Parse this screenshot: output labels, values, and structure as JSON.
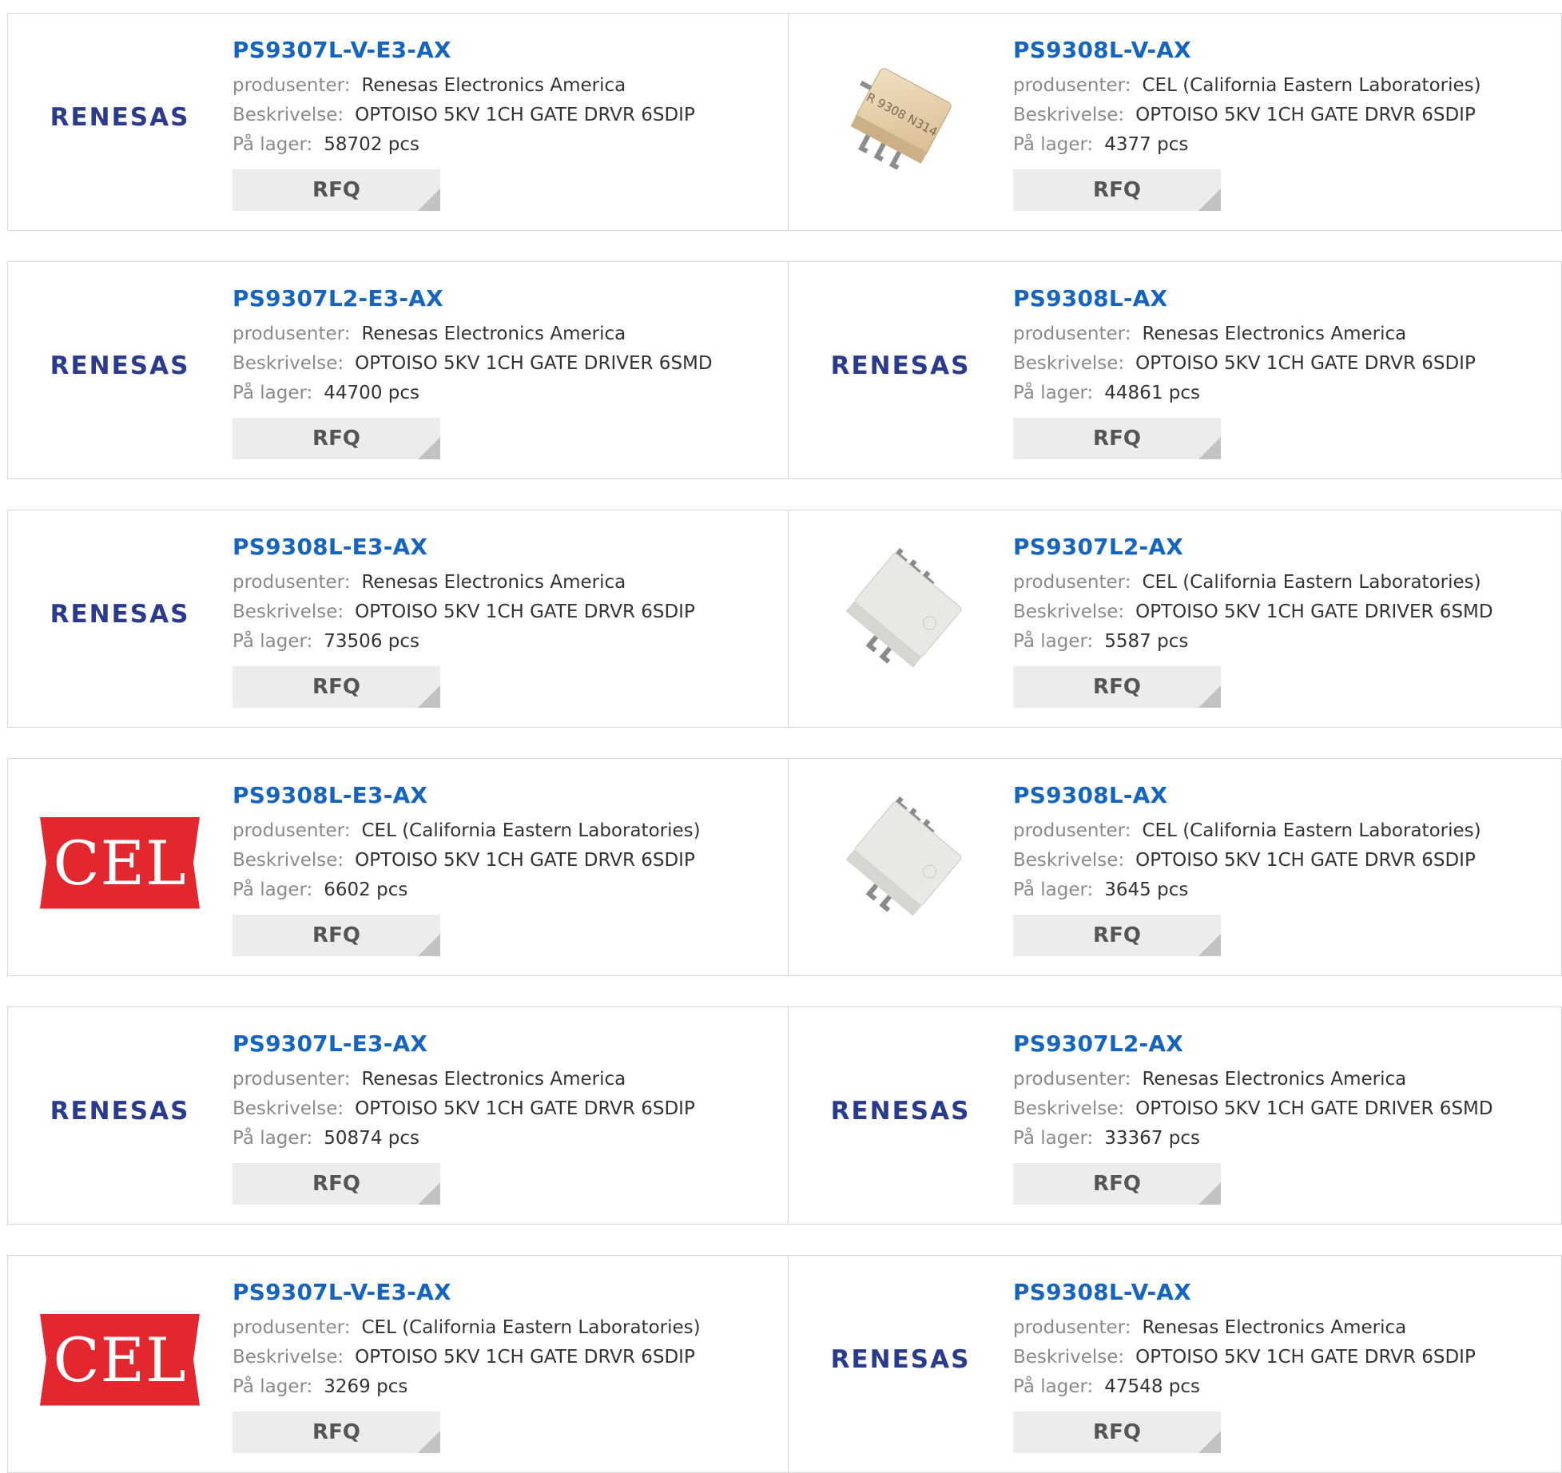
{
  "labels": {
    "maker": "produsenter:",
    "desc": "Beskrivelse:",
    "stock": "På lager:",
    "rfq": "RFQ"
  },
  "rows": [
    [
      {
        "part": "PS9307L-V-E3-AX",
        "maker": "Renesas Electronics America",
        "desc": "OPTOISO 5KV 1CH GATE DRVR 6SDIP",
        "stock": "58702 pcs",
        "image": "renesas-logo",
        "logo_text": "RENESAS"
      },
      {
        "part": "PS9308L-V-AX",
        "maker": "CEL (California Eastern Laboratories)",
        "desc": "OPTOISO 5KV 1CH GATE DRVR 6SDIP",
        "stock": "4377 pcs",
        "image": "chip-tan",
        "chip_mark": "R 9308 N314"
      }
    ],
    [
      {
        "part": "PS9307L2-E3-AX",
        "maker": "Renesas Electronics America",
        "desc": "OPTOISO 5KV 1CH GATE DRIVER 6SMD",
        "stock": "44700 pcs",
        "image": "renesas-logo",
        "logo_text": "RENESAS"
      },
      {
        "part": "PS9308L-AX",
        "maker": "Renesas Electronics America",
        "desc": "OPTOISO 5KV 1CH GATE DRVR 6SDIP",
        "stock": "44861 pcs",
        "image": "renesas-logo",
        "logo_text": "RENESAS"
      }
    ],
    [
      {
        "part": "PS9308L-E3-AX",
        "maker": "Renesas Electronics America",
        "desc": "OPTOISO 5KV 1CH GATE DRVR 6SDIP",
        "stock": "73506 pcs",
        "image": "renesas-logo",
        "logo_text": "RENESAS"
      },
      {
        "part": "PS9307L2-AX",
        "maker": "CEL (California Eastern Laboratories)",
        "desc": "OPTOISO 5KV 1CH GATE DRIVER 6SMD",
        "stock": "5587 pcs",
        "image": "chip-white"
      }
    ],
    [
      {
        "part": "PS9308L-E3-AX",
        "maker": "CEL (California Eastern Laboratories)",
        "desc": "OPTOISO 5KV 1CH GATE DRVR 6SDIP",
        "stock": "6602 pcs",
        "image": "cel-logo",
        "logo_text": "CEL"
      },
      {
        "part": "PS9308L-AX",
        "maker": "CEL (California Eastern Laboratories)",
        "desc": "OPTOISO 5KV 1CH GATE DRVR 6SDIP",
        "stock": "3645 pcs",
        "image": "chip-white"
      }
    ],
    [
      {
        "part": "PS9307L-E3-AX",
        "maker": "Renesas Electronics America",
        "desc": "OPTOISO 5KV 1CH GATE DRVR 6SDIP",
        "stock": "50874 pcs",
        "image": "renesas-logo",
        "logo_text": "RENESAS"
      },
      {
        "part": "PS9307L2-AX",
        "maker": "Renesas Electronics America",
        "desc": "OPTOISO 5KV 1CH GATE DRIVER 6SMD",
        "stock": "33367 pcs",
        "image": "renesas-logo",
        "logo_text": "RENESAS"
      }
    ],
    [
      {
        "part": "PS9307L-V-E3-AX",
        "maker": "CEL (California Eastern Laboratories)",
        "desc": "OPTOISO 5KV 1CH GATE DRVR 6SDIP",
        "stock": "3269 pcs",
        "image": "cel-logo",
        "logo_text": "CEL"
      },
      {
        "part": "PS9308L-V-AX",
        "maker": "Renesas Electronics America",
        "desc": "OPTOISO 5KV 1CH GATE DRVR 6SDIP",
        "stock": "47548 pcs",
        "image": "renesas-logo",
        "logo_text": "RENESAS"
      }
    ]
  ],
  "colors": {
    "link": "#1565c0",
    "label": "#8a8a8a",
    "value": "#333333",
    "border": "#d6d6d6",
    "rfq_bg": "#ececec",
    "renesas": "#2a3a8c",
    "cel_red": "#e3272f"
  }
}
